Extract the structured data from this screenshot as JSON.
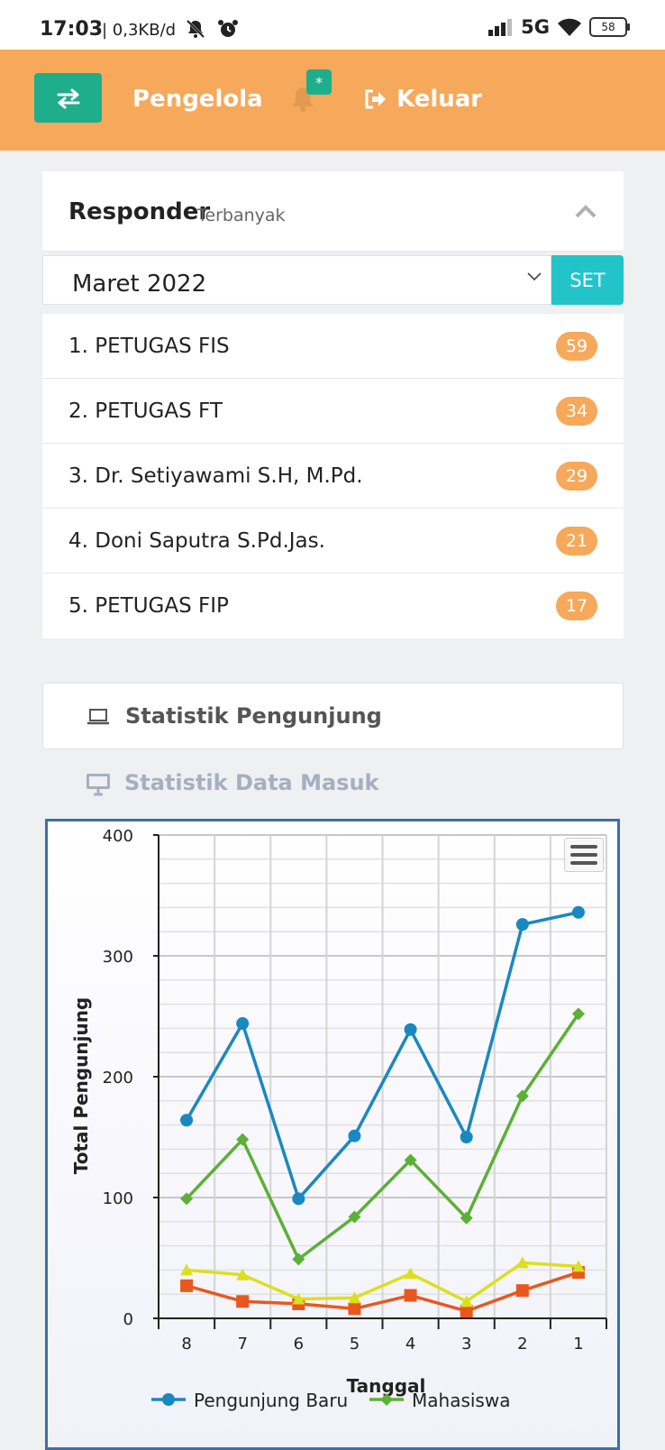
{
  "status_bar": {
    "time": "17:03",
    "network_speed": "| 0,3KB/d",
    "network_type": "5G",
    "battery": "58",
    "icons": [
      "mute-icon",
      "alarm-icon",
      "signal-icon",
      "wifi-icon",
      "battery-icon"
    ]
  },
  "header": {
    "title": "Pengelola",
    "notification_badge": "*",
    "logout_label": "Keluar",
    "colors": {
      "background": "#f6a95a",
      "toggle": "#1eae8c"
    }
  },
  "responder": {
    "title": "Responder",
    "subtitle": "Terbanyak",
    "month_selected": "Maret 2022",
    "set_label": "SET",
    "items": [
      {
        "label": "1. PETUGAS FIS",
        "count": "59"
      },
      {
        "label": "2. PETUGAS FT",
        "count": "34"
      },
      {
        "label": "3. Dr. Setiyawami S.H, M.Pd.",
        "count": "29"
      },
      {
        "label": "4. Doni Saputra S.Pd.Jas.",
        "count": "21"
      },
      {
        "label": "5. PETUGAS FIP",
        "count": "17"
      }
    ]
  },
  "tabs": [
    {
      "label": "Statistik Pengunjung",
      "icon": "laptop-icon",
      "active": true
    },
    {
      "label": "Statistik Data Masuk",
      "icon": "monitor-icon",
      "active": false
    }
  ],
  "chart_data": {
    "type": "line",
    "xlabel": "Tanggal",
    "ylabel": "Total Pengunjung",
    "ylim": [
      0,
      400
    ],
    "yticks": [
      "0",
      "100",
      "200",
      "300",
      "400"
    ],
    "categories": [
      "8",
      "7",
      "6",
      "5",
      "4",
      "3",
      "2",
      "1"
    ],
    "grid": true,
    "legend_position": "bottom",
    "series": [
      {
        "name": "Pengunjung Baru",
        "color": "#1a88c0",
        "marker": "circle",
        "values": [
          164,
          244,
          99,
          151,
          239,
          150,
          326,
          336
        ]
      },
      {
        "name": "Mahasiswa",
        "color": "#5bb035",
        "marker": "diamond",
        "values": [
          99,
          148,
          49,
          84,
          131,
          83,
          184,
          252
        ]
      },
      {
        "color": "#dbe01e",
        "marker": "triangle",
        "values": [
          40,
          36,
          16,
          17,
          37,
          14,
          46,
          43
        ]
      },
      {
        "color": "#e8581e",
        "marker": "square",
        "values": [
          27,
          14,
          12,
          8,
          19,
          6,
          23,
          38
        ]
      }
    ]
  }
}
